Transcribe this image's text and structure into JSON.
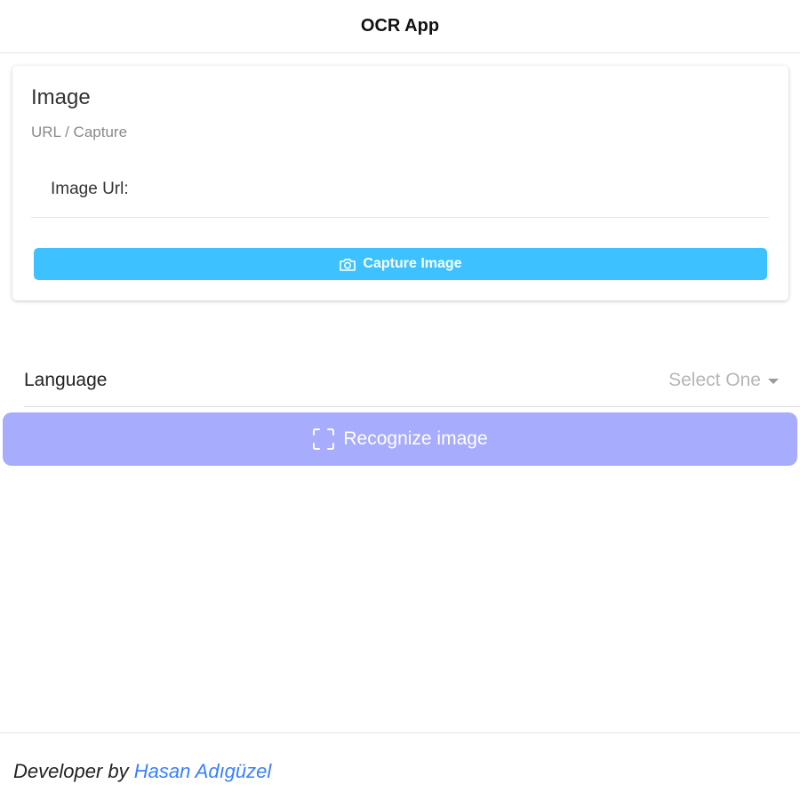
{
  "header": {
    "title": "OCR App"
  },
  "image_card": {
    "title": "Image",
    "subtitle": "URL / Capture",
    "url_label": "Image Url:",
    "url_value": "",
    "capture_label": "Capture Image",
    "capture_icon": "camera-icon"
  },
  "language": {
    "label": "Language",
    "placeholder": "Select One",
    "icon": "caret-down-icon"
  },
  "recognize": {
    "label": "Recognize image",
    "icon": "scan-icon"
  },
  "footer": {
    "prefix": "Developer by",
    "author": "Hasan Adıgüzel"
  },
  "colors": {
    "capture_button": "#3dc2ff",
    "recognize_button": "#a7acfc",
    "footer_link": "#3880ff"
  }
}
